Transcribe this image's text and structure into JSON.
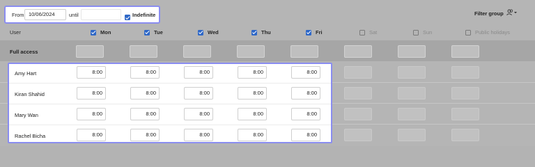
{
  "date_range": {
    "from_label": "From",
    "from_value": "10/06/2024",
    "until_label": "until",
    "until_value": "",
    "indefinite_label": "Indefinite",
    "indefinite_checked": true
  },
  "filter": {
    "label": "Filter group",
    "icon": "users-filter-icon"
  },
  "columns": {
    "user_header": "User",
    "days": [
      {
        "label": "Mon",
        "checked": true
      },
      {
        "label": "Tue",
        "checked": true
      },
      {
        "label": "Wed",
        "checked": true
      },
      {
        "label": "Thu",
        "checked": true
      },
      {
        "label": "Fri",
        "checked": true
      },
      {
        "label": "Sat",
        "checked": false
      },
      {
        "label": "Sun",
        "checked": false
      },
      {
        "label": "Public holidays",
        "checked": false
      }
    ]
  },
  "full_access": {
    "label": "Full access"
  },
  "users": [
    {
      "name": "Amy Hart",
      "times": [
        "8:00",
        "8:00",
        "8:00",
        "8:00",
        "8:00"
      ]
    },
    {
      "name": "Kiran Shahid",
      "times": [
        "8:00",
        "8:00",
        "8:00",
        "8:00",
        "8:00"
      ]
    },
    {
      "name": "Mary Wan",
      "times": [
        "8:00",
        "8:00",
        "8:00",
        "8:00",
        "8:00"
      ]
    },
    {
      "name": "Rachel Bicha",
      "times": [
        "8:00",
        "8:00",
        "8:00",
        "8:00",
        "8:00"
      ]
    }
  ],
  "colors": {
    "highlight": "#8a8df0",
    "checkbox": "#2f68c7",
    "overlay": "#b5b5b5"
  }
}
